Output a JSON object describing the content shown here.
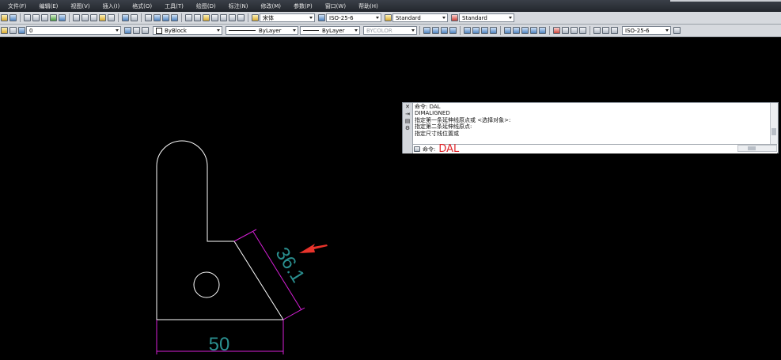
{
  "menu": [
    "文件(F)",
    "编辑(E)",
    "视图(V)",
    "插入(I)",
    "格式(O)",
    "工具(T)",
    "绘图(D)",
    "标注(N)",
    "修改(M)",
    "参数(P)",
    "窗口(W)",
    "帮助(H)"
  ],
  "toolbar1": {
    "text_style": "宋体",
    "dim_style": "ISO-25-6",
    "table_style": "Standard",
    "multileader_style": "Standard"
  },
  "toolbar2": {
    "layer": "0",
    "color": "ByBlock",
    "linetype": "ByLayer",
    "lineweight": "ByLayer",
    "plot_style": "BYCOLOR",
    "dim_style": "ISO-25-6"
  },
  "command_window": {
    "history": [
      "命令: DAL",
      "DIMALIGNED",
      "指定第一条延伸线原点或 <选择对象>:",
      "指定第二条延伸线原点:",
      "指定尺寸线位置或"
    ],
    "prompt": "命令:",
    "input": "DAL"
  },
  "drawing": {
    "dimension_horizontal": "50",
    "dimension_aligned": "36.1",
    "colors": {
      "geometry": "#ffffff",
      "dimension_lines": "#d61fd6",
      "dimension_text": "#2a8f8f",
      "arrow": "#e8332b"
    }
  }
}
